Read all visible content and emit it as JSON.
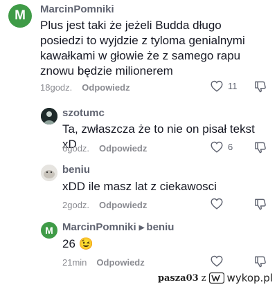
{
  "comments": [
    {
      "avatar_letter": "M",
      "avatar_color": "#3f9b47",
      "username": "MarcinPomniki",
      "text": "Plus jest taki że jeżeli Budda długo posiedzi to wyjdzie z tyloma genialnymi kawałkami w głowie że z samego rapu znowu będzie milionerem",
      "time": "18godz.",
      "reply_label": "Odpowiedz",
      "likes": "11"
    },
    {
      "username": "szotumc",
      "text": "Ta, zwłaszcza że to nie on pisał tekst xD",
      "time": "6godz.",
      "reply_label": "Odpowiedz",
      "likes": "6"
    },
    {
      "username": "beniu",
      "text": "xDD ile masz lat z ciekawosci",
      "time": "2godz.",
      "reply_label": "Odpowiedz",
      "likes": ""
    },
    {
      "avatar_letter": "M",
      "avatar_color": "#3f9b47",
      "username": "MarcinPomniki",
      "reply_to": "beniu",
      "text": "26 😉",
      "time": "21min",
      "reply_label": "Odpowiedz",
      "likes": ""
    }
  ],
  "watermark": {
    "user": "pasza03",
    "connector": "z",
    "site": "wykop.pl"
  },
  "icons": {
    "like": "heart-outline-icon",
    "dislike": "thumbs-down-outline-icon",
    "site_logo": "wykop-logo-icon"
  }
}
